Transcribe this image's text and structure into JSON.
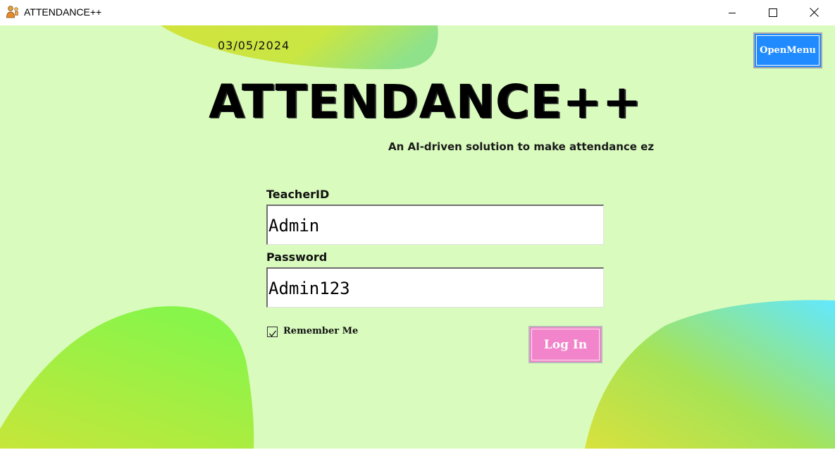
{
  "window": {
    "title": "ATTENDANCE++",
    "controls": {
      "minimize_icon": "minimize-icon",
      "maximize_icon": "maximize-icon",
      "close_icon": "close-icon"
    }
  },
  "header": {
    "date": "03/05/2024",
    "open_menu_label": "OpenMenu",
    "app_title": "ATTENDANCE++",
    "tagline": "An AI-driven solution to make attendance ez"
  },
  "login_form": {
    "teacher_id_label": "TeacherID",
    "teacher_id_value": "Admin",
    "password_label": "Password",
    "password_value": "Admin123",
    "remember_me_label": "Remember Me",
    "remember_me_checked": true,
    "login_button_label": "Log In"
  },
  "colors": {
    "background": "#d9fbbe",
    "open_menu_button": "#1f8bff",
    "login_button": "#f184ca"
  }
}
